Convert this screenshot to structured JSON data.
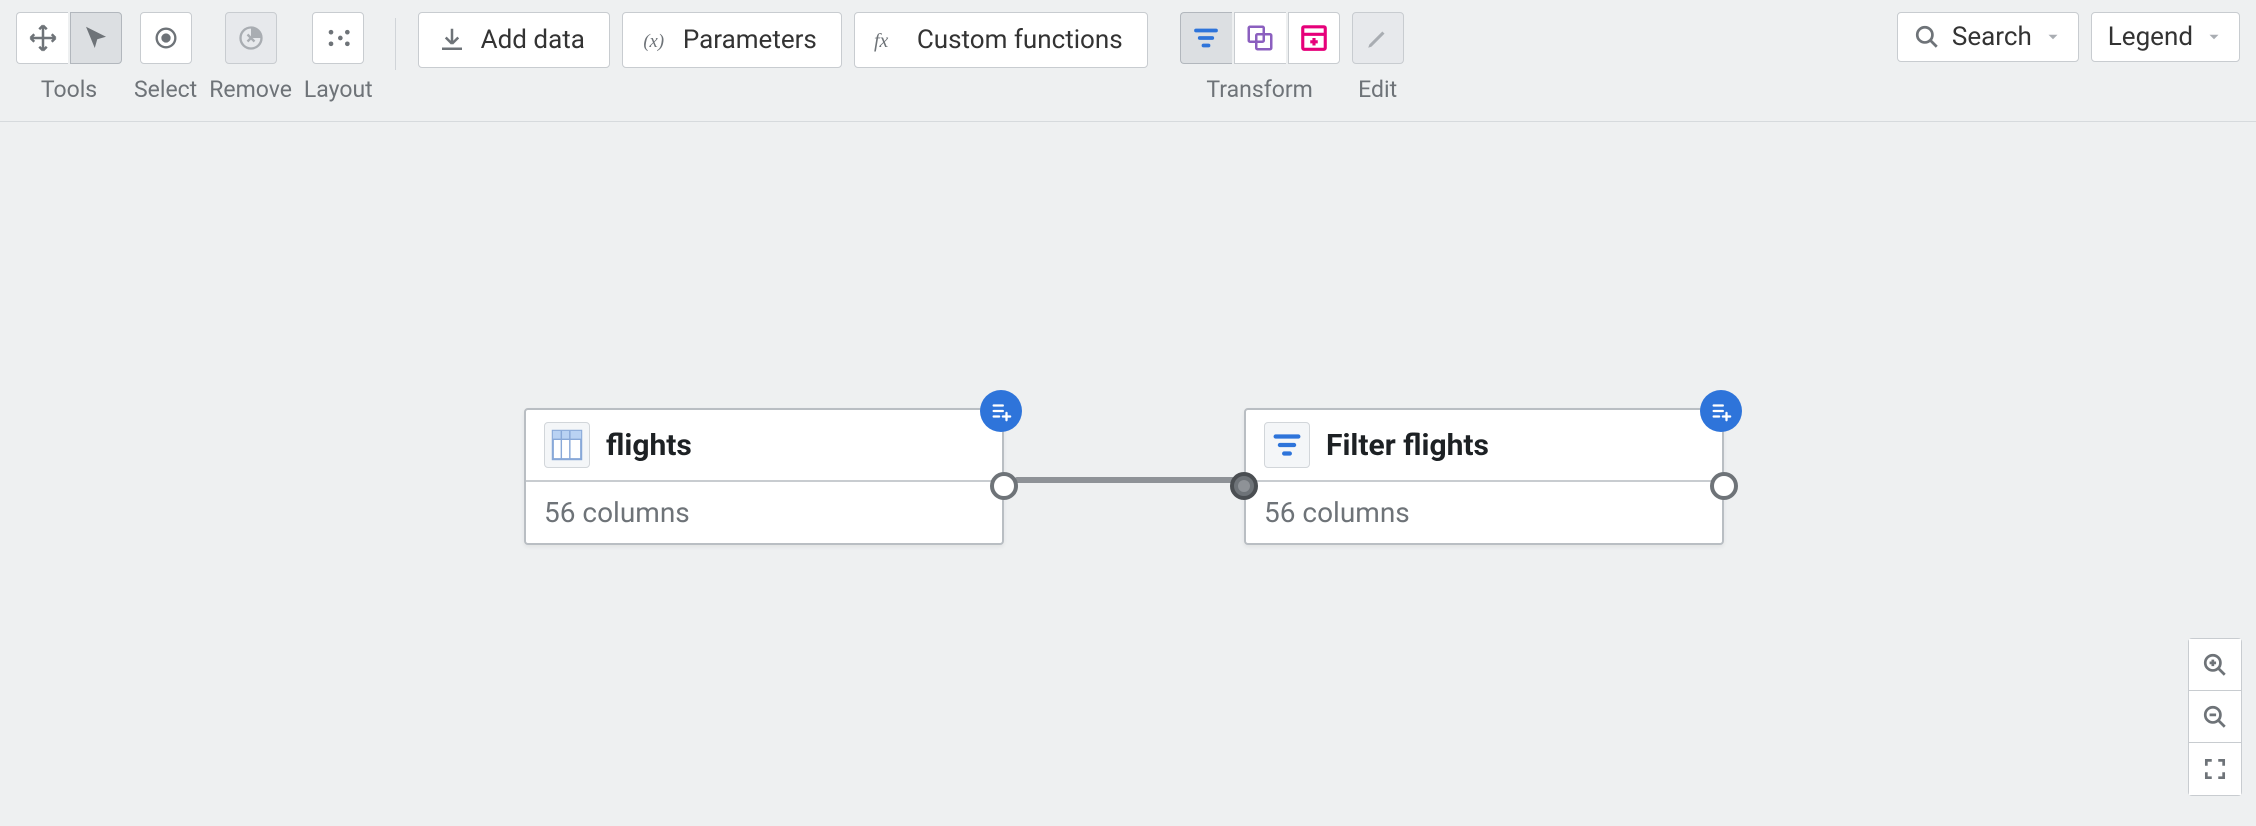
{
  "toolbar": {
    "tools_label": "Tools",
    "select_label": "Select",
    "remove_label": "Remove",
    "layout_label": "Layout",
    "add_data_label": "Add data",
    "parameters_label": "Parameters",
    "custom_functions_label": "Custom functions",
    "transform_label": "Transform",
    "edit_label": "Edit",
    "search_label": "Search",
    "legend_label": "Legend"
  },
  "nodes": {
    "flights": {
      "title": "flights",
      "subtitle": "56 columns"
    },
    "filter_flights": {
      "title": "Filter flights",
      "subtitle": "56 columns"
    }
  }
}
